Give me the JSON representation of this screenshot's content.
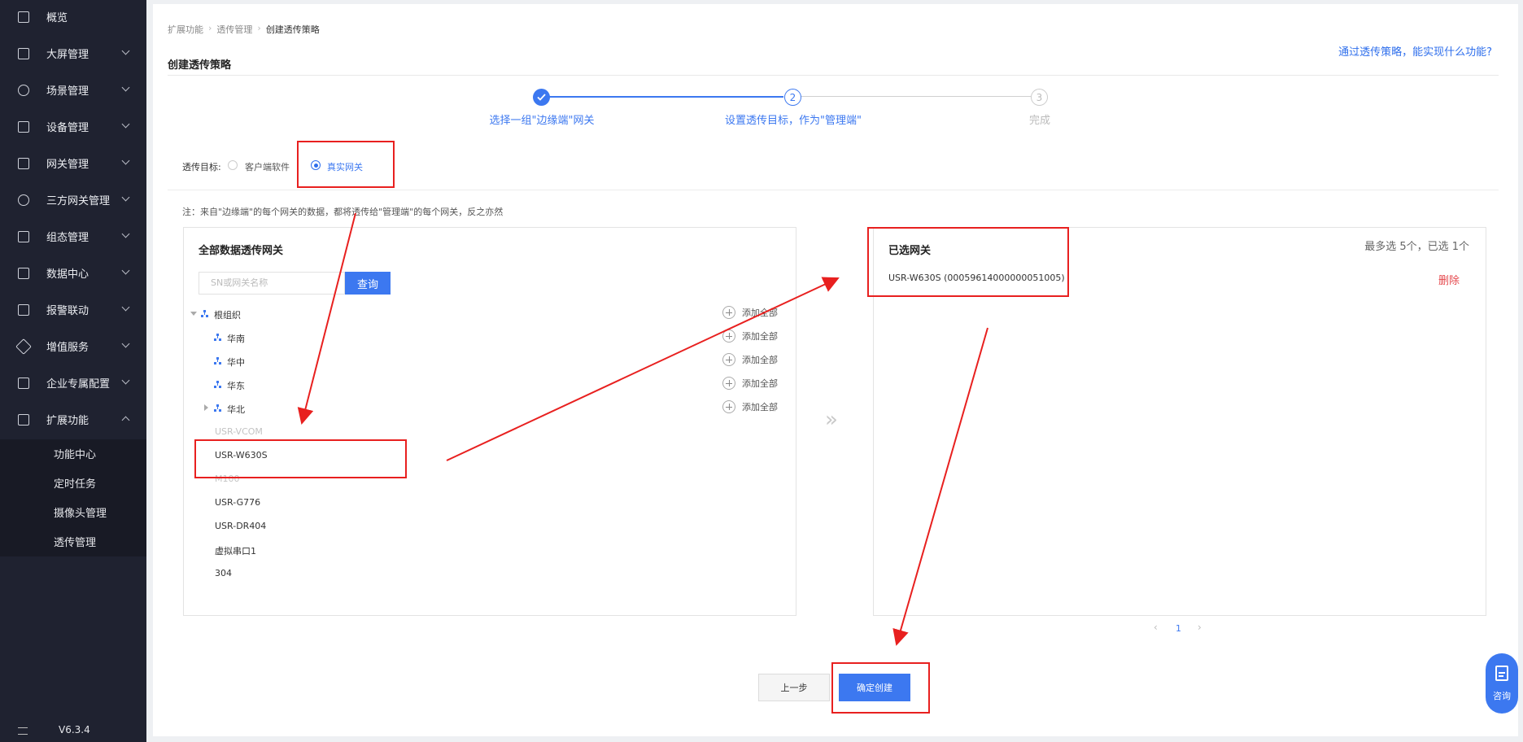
{
  "sidebar": {
    "items": [
      {
        "label": "概览",
        "icon": "overview-icon"
      },
      {
        "label": "大屏管理",
        "icon": "screen-icon"
      },
      {
        "label": "场景管理",
        "icon": "scene-icon"
      },
      {
        "label": "设备管理",
        "icon": "device-icon"
      },
      {
        "label": "网关管理",
        "icon": "gateway-icon"
      },
      {
        "label": "三方网关管理",
        "icon": "third-party-gateway-icon"
      },
      {
        "label": "组态管理",
        "icon": "configuration-icon"
      },
      {
        "label": "数据中心",
        "icon": "data-center-icon"
      },
      {
        "label": "报警联动",
        "icon": "alarm-icon"
      },
      {
        "label": "增值服务",
        "icon": "value-added-icon"
      },
      {
        "label": "企业专属配置",
        "icon": "enterprise-icon"
      },
      {
        "label": "扩展功能",
        "icon": "extension-icon"
      }
    ],
    "submenu": [
      "功能中心",
      "定时任务",
      "摄像头管理",
      "透传管理"
    ],
    "version": "V6.3.4"
  },
  "breadcrumb": [
    "扩展功能",
    "透传管理",
    "创建透传策略"
  ],
  "page_title": "创建透传策略",
  "help_link": "通过透传策略，能实现什么功能?",
  "steps": [
    {
      "number": "1",
      "label": "选择一组\"边缘端\"网关",
      "state": "done"
    },
    {
      "number": "2",
      "label": "设置透传目标，作为\"管理端\"",
      "state": "active"
    },
    {
      "number": "3",
      "label": "完成",
      "state": "pending"
    }
  ],
  "target": {
    "label": "透传目标:",
    "options": [
      "客户端软件",
      "真实网关"
    ],
    "selected": "真实网关"
  },
  "note": "注：来自\"边缘端\"的每个网关的数据，都将透传给\"管理端\"的每个网关，反之亦然",
  "left_panel": {
    "title": "全部数据透传网关",
    "search_placeholder": "SN或网关名称",
    "query_label": "查询",
    "add_all_label": "添加全部",
    "tree": [
      {
        "name": "根组织",
        "level": 0,
        "expanded": true
      },
      {
        "name": "华南",
        "level": 1
      },
      {
        "name": "华中",
        "level": 1
      },
      {
        "name": "华东",
        "level": 1
      },
      {
        "name": "华北",
        "level": 1,
        "collapsed": true
      }
    ],
    "gateways": [
      {
        "name": "USR-VCOM",
        "disabled": true
      },
      {
        "name": "USR-W630S",
        "disabled": false
      },
      {
        "name": "M100",
        "disabled": true
      },
      {
        "name": "USR-G776",
        "disabled": false
      },
      {
        "name": "USR-DR404",
        "disabled": false
      },
      {
        "name": "虚拟串口1",
        "disabled": false
      },
      {
        "name": "304",
        "disabled": false
      }
    ]
  },
  "transfer_arrow": "»",
  "right_panel": {
    "title": "已选网关",
    "count_text": "最多选 5个，已选 1个",
    "selected": [
      {
        "name": "USR-W630S (00059614000000051005)",
        "delete_label": "删除"
      }
    ],
    "pager": {
      "prev": "‹",
      "page": "1",
      "next": "›"
    }
  },
  "buttons": {
    "prev": "上一步",
    "confirm": "确定创建"
  },
  "consult_label": "咨询",
  "colors": {
    "accent": "#3c78f0",
    "sidebar_bg": "#1f2230",
    "annotation": "#e8201f",
    "danger": "#e5484d"
  }
}
